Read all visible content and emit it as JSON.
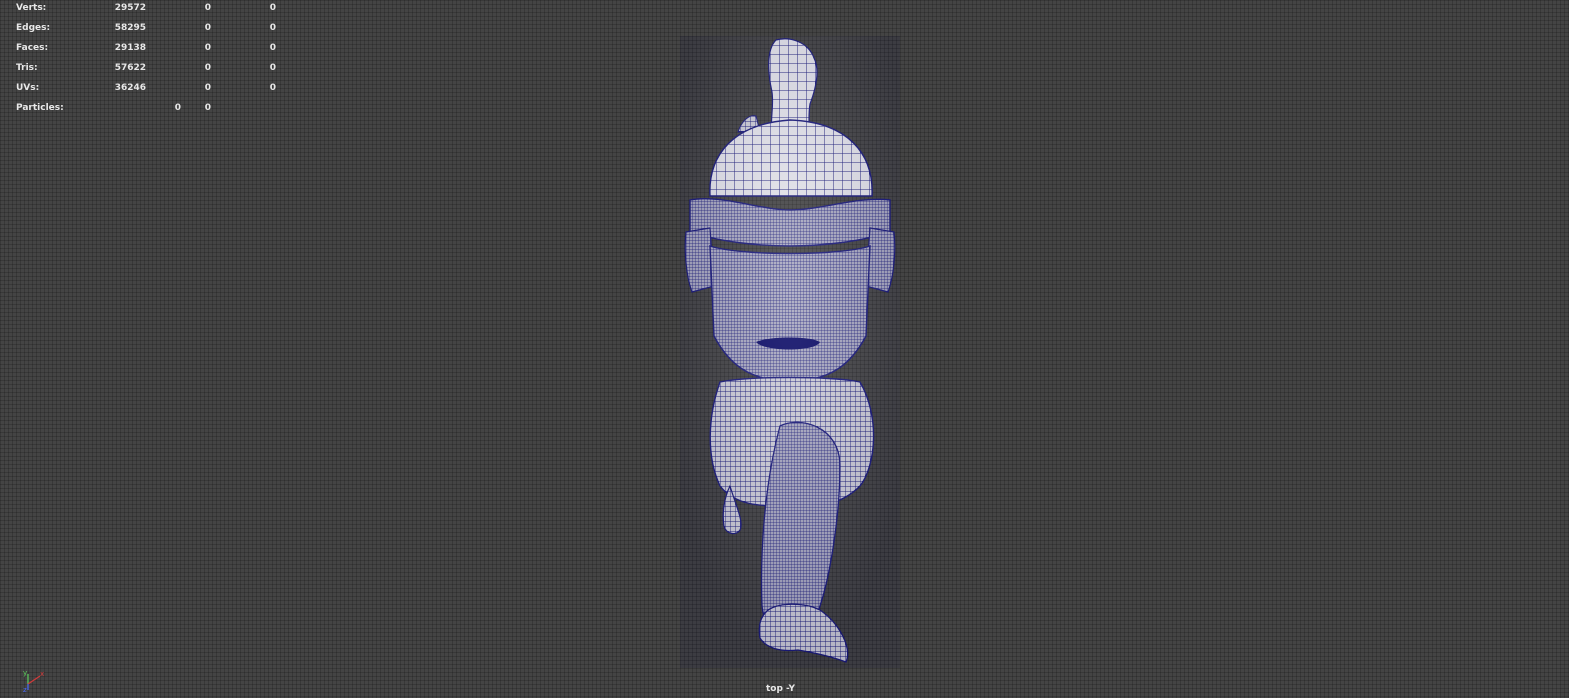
{
  "hud": {
    "rows": [
      {
        "label": "Verts:",
        "v1": "29572",
        "v2": "0",
        "v3": "0"
      },
      {
        "label": "Edges:",
        "v1": "58295",
        "v2": "0",
        "v3": "0"
      },
      {
        "label": "Faces:",
        "v1": "29138",
        "v2": "0",
        "v3": "0"
      },
      {
        "label": "Tris:",
        "v1": "57622",
        "v2": "0",
        "v3": "0"
      },
      {
        "label": "UVs:",
        "v1": "36246",
        "v2": "0",
        "v3": "0"
      },
      {
        "label": "Particles:",
        "v1": "0",
        "v2": "0"
      }
    ]
  },
  "camera_label": "top -Y",
  "axis": {
    "y": "y",
    "x": "x",
    "z": "z"
  },
  "colors": {
    "background": "#444444",
    "wireframe": "#1a1a7a",
    "surface": "#d8d8de",
    "axis_x": "#d23a3a",
    "axis_y": "#5ed35e",
    "axis_z": "#4a6cff"
  },
  "icons": [
    "axis-gizmo-icon"
  ]
}
